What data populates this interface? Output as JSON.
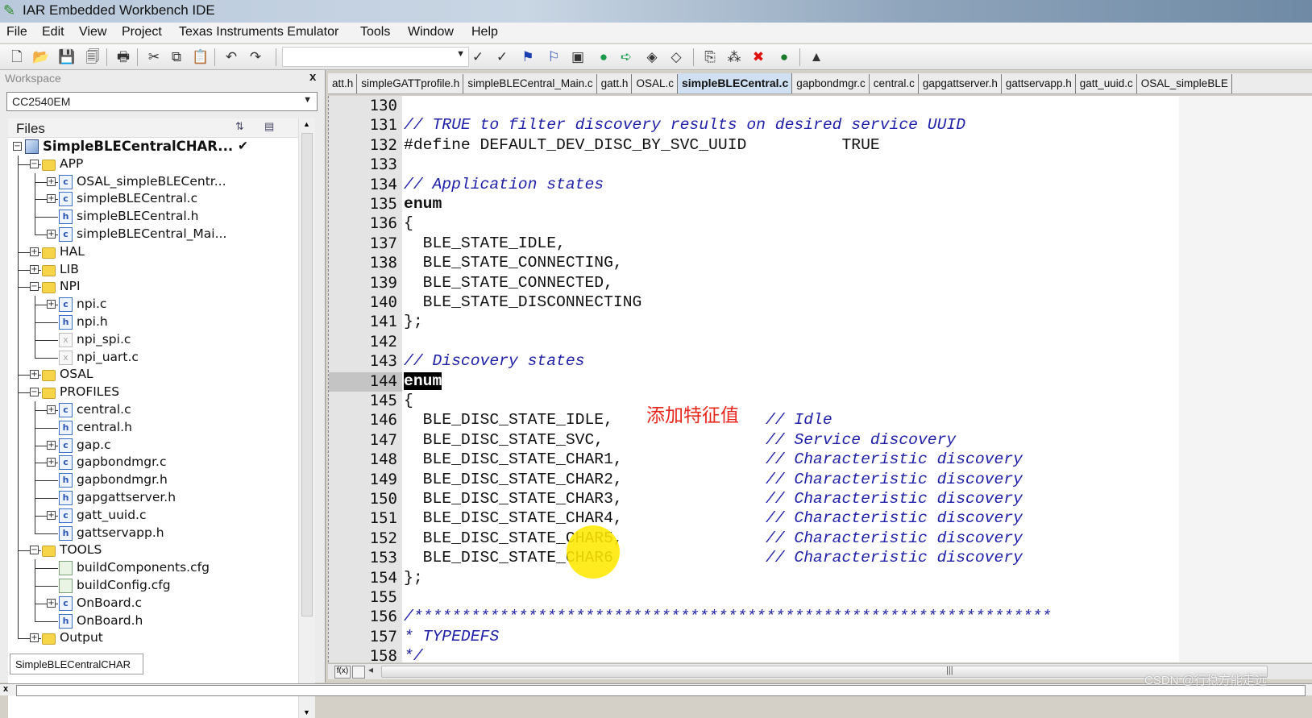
{
  "window": {
    "title": "IAR Embedded Workbench IDE"
  },
  "menu": [
    "File",
    "Edit",
    "View",
    "Project",
    "Texas Instruments Emulator",
    "Tools",
    "Window",
    "Help"
  ],
  "toolbar": {
    "icons": [
      "new-file-icon",
      "open-folder-icon",
      "save-icon",
      "save-all-icon",
      "print-icon",
      "cut-icon",
      "copy-icon",
      "paste-icon",
      "undo-icon",
      "redo-icon",
      "find-combo",
      "bookmark-icon",
      "bookmark-next-icon",
      "toggle-breakpoint-icon",
      "breakpoint-list-icon",
      "go-to-icon",
      "step-icon",
      "step-over-icon",
      "step-back-icon",
      "compile-icon",
      "make-icon",
      "stop-build-icon",
      "breakpoint-icon",
      "download-debug-icon",
      "debug-no-download-icon"
    ],
    "glyphs": [
      "🗋",
      "📂",
      "💾",
      "🗐",
      "🖶",
      "✂",
      "⧉",
      "📋",
      "↶",
      "↷",
      "",
      "✓",
      "✓",
      "⚑",
      "⚐",
      "▣",
      "●",
      "➪",
      "◈",
      "◇",
      "⎘",
      "⁂",
      "✖",
      "●",
      "▲",
      "△"
    ]
  },
  "workspace": {
    "title": "Workspace",
    "close": "x",
    "config": "CC2540EM",
    "files_label": "Files",
    "bottom_tab": "SimpleBLECentralCHAR",
    "tree": [
      {
        "label": "SimpleBLECentralCHAR...",
        "depth": 0,
        "icon": "project",
        "exp": "minus",
        "check": "✔"
      },
      {
        "label": "APP",
        "depth": 1,
        "icon": "folder",
        "exp": "minus"
      },
      {
        "label": "OSAL_simpleBLECentr...",
        "depth": 2,
        "icon": "cfile",
        "exp": "plus"
      },
      {
        "label": "simpleBLECentral.c",
        "depth": 2,
        "icon": "cfile",
        "exp": "plus"
      },
      {
        "label": "simpleBLECentral.h",
        "depth": 2,
        "icon": "hfile"
      },
      {
        "label": "simpleBLECentral_Mai...",
        "depth": 2,
        "icon": "cfile",
        "exp": "plus",
        "last": true
      },
      {
        "label": "HAL",
        "depth": 1,
        "icon": "folder",
        "exp": "plus"
      },
      {
        "label": "LIB",
        "depth": 1,
        "icon": "folder",
        "exp": "plus"
      },
      {
        "label": "NPI",
        "depth": 1,
        "icon": "folder",
        "exp": "minus"
      },
      {
        "label": "npi.c",
        "depth": 2,
        "icon": "cfile",
        "exp": "plus"
      },
      {
        "label": "npi.h",
        "depth": 2,
        "icon": "hfile"
      },
      {
        "label": "npi_spi.c",
        "depth": 2,
        "icon": "xfile"
      },
      {
        "label": "npi_uart.c",
        "depth": 2,
        "icon": "xfile",
        "last": true
      },
      {
        "label": "OSAL",
        "depth": 1,
        "icon": "folder",
        "exp": "plus"
      },
      {
        "label": "PROFILES",
        "depth": 1,
        "icon": "folder",
        "exp": "minus"
      },
      {
        "label": "central.c",
        "depth": 2,
        "icon": "cfile",
        "exp": "plus"
      },
      {
        "label": "central.h",
        "depth": 2,
        "icon": "hfile"
      },
      {
        "label": "gap.c",
        "depth": 2,
        "icon": "cfile",
        "exp": "plus"
      },
      {
        "label": "gapbondmgr.c",
        "depth": 2,
        "icon": "cfile",
        "exp": "plus"
      },
      {
        "label": "gapbondmgr.h",
        "depth": 2,
        "icon": "hfile"
      },
      {
        "label": "gapgattserver.h",
        "depth": 2,
        "icon": "hfile"
      },
      {
        "label": "gatt_uuid.c",
        "depth": 2,
        "icon": "cfile",
        "exp": "plus"
      },
      {
        "label": "gattservapp.h",
        "depth": 2,
        "icon": "hfile",
        "last": true
      },
      {
        "label": "TOOLS",
        "depth": 1,
        "icon": "folder",
        "exp": "minus"
      },
      {
        "label": "buildComponents.cfg",
        "depth": 2,
        "icon": "cfg"
      },
      {
        "label": "buildConfig.cfg",
        "depth": 2,
        "icon": "cfg"
      },
      {
        "label": "OnBoard.c",
        "depth": 2,
        "icon": "cfile",
        "exp": "plus"
      },
      {
        "label": "OnBoard.h",
        "depth": 2,
        "icon": "hfile",
        "last": true
      },
      {
        "label": "Output",
        "depth": 1,
        "icon": "folder",
        "exp": "plus",
        "last": true
      }
    ]
  },
  "editor": {
    "tabs": [
      "att.h",
      "simpleGATTprofile.h",
      "simpleBLECentral_Main.c",
      "gatt.h",
      "OSAL.c",
      "simpleBLECentral.c",
      "gapbondmgr.c",
      "central.c",
      "gapgattserver.h",
      "gattservapp.h",
      "gatt_uuid.c",
      "OSAL_simpleBLE"
    ],
    "active_tab": "simpleBLECentral.c",
    "highlight_line": "144",
    "lines": [
      {
        "n": "130",
        "p": []
      },
      {
        "n": "131",
        "p": [
          {
            "t": "// TRUE to filter discovery results on desired service UUID",
            "c": "com"
          }
        ]
      },
      {
        "n": "132",
        "p": [
          {
            "t": "#define DEFAULT_DEV_DISC_BY_SVC_UUID          TRUE",
            "c": "pre"
          }
        ]
      },
      {
        "n": "133",
        "p": []
      },
      {
        "n": "134",
        "p": [
          {
            "t": "// Application states",
            "c": "com"
          }
        ]
      },
      {
        "n": "135",
        "p": [
          {
            "t": "enum",
            "c": "kw"
          }
        ]
      },
      {
        "n": "136",
        "p": [
          {
            "t": "{",
            "c": "code"
          }
        ]
      },
      {
        "n": "137",
        "p": [
          {
            "t": "  BLE_STATE_IDLE,",
            "c": "code"
          }
        ]
      },
      {
        "n": "138",
        "p": [
          {
            "t": "  BLE_STATE_CONNECTING,",
            "c": "code"
          }
        ]
      },
      {
        "n": "139",
        "p": [
          {
            "t": "  BLE_STATE_CONNECTED,",
            "c": "code"
          }
        ]
      },
      {
        "n": "140",
        "p": [
          {
            "t": "  BLE_STATE_DISCONNECTING",
            "c": "code"
          }
        ]
      },
      {
        "n": "141",
        "p": [
          {
            "t": "};",
            "c": "code"
          }
        ]
      },
      {
        "n": "142",
        "p": []
      },
      {
        "n": "143",
        "p": [
          {
            "t": "// Discovery states",
            "c": "com"
          }
        ]
      },
      {
        "n": "144",
        "p": [
          {
            "t": "enum",
            "c": "sel"
          }
        ]
      },
      {
        "n": "145",
        "p": [
          {
            "t": "{",
            "c": "code"
          }
        ]
      },
      {
        "n": "146",
        "p": [
          {
            "t": "  BLE_DISC_STATE_IDLE,                ",
            "c": "code"
          },
          {
            "t": "// Idle",
            "c": "com"
          }
        ]
      },
      {
        "n": "147",
        "p": [
          {
            "t": "  BLE_DISC_STATE_SVC,                 ",
            "c": "code"
          },
          {
            "t": "// Service discovery",
            "c": "com"
          }
        ]
      },
      {
        "n": "148",
        "p": [
          {
            "t": "  BLE_DISC_STATE_CHAR1,               ",
            "c": "code"
          },
          {
            "t": "// Characteristic discovery",
            "c": "com"
          }
        ]
      },
      {
        "n": "149",
        "p": [
          {
            "t": "  BLE_DISC_STATE_CHAR2,               ",
            "c": "code"
          },
          {
            "t": "// Characteristic discovery",
            "c": "com"
          }
        ]
      },
      {
        "n": "150",
        "p": [
          {
            "t": "  BLE_DISC_STATE_CHAR3,               ",
            "c": "code"
          },
          {
            "t": "// Characteristic discovery",
            "c": "com"
          }
        ]
      },
      {
        "n": "151",
        "p": [
          {
            "t": "  BLE_DISC_STATE_CHAR4,               ",
            "c": "code"
          },
          {
            "t": "// Characteristic discovery",
            "c": "com"
          }
        ]
      },
      {
        "n": "152",
        "p": [
          {
            "t": "  BLE_DISC_STATE_CHAR5,               ",
            "c": "code"
          },
          {
            "t": "// Characteristic discovery",
            "c": "com"
          }
        ]
      },
      {
        "n": "153",
        "p": [
          {
            "t": "  BLE_DISC_STATE_CHAR6                ",
            "c": "code"
          },
          {
            "t": "// Characteristic discovery",
            "c": "com"
          }
        ]
      },
      {
        "n": "154",
        "p": [
          {
            "t": "};",
            "c": "code"
          }
        ]
      },
      {
        "n": "155",
        "p": []
      },
      {
        "n": "156",
        "p": [
          {
            "t": "/*******************************************************************",
            "c": "com"
          }
        ]
      },
      {
        "n": "157",
        "p": [
          {
            "t": "* TYPEDEFS",
            "c": "com"
          }
        ]
      },
      {
        "n": "158",
        "p": [
          {
            "t": "*/",
            "c": "com"
          }
        ]
      }
    ],
    "annotation": "添加特征值",
    "fx_label": "f(x)"
  },
  "status": {
    "close": "x"
  },
  "watermark": "CSDN @行稳方能走远",
  "colors": {
    "comment": "#2020a8",
    "annotation": "#e8261c",
    "active_tab": "#cfe0f3",
    "cursor_highlight": "#ffe800"
  }
}
